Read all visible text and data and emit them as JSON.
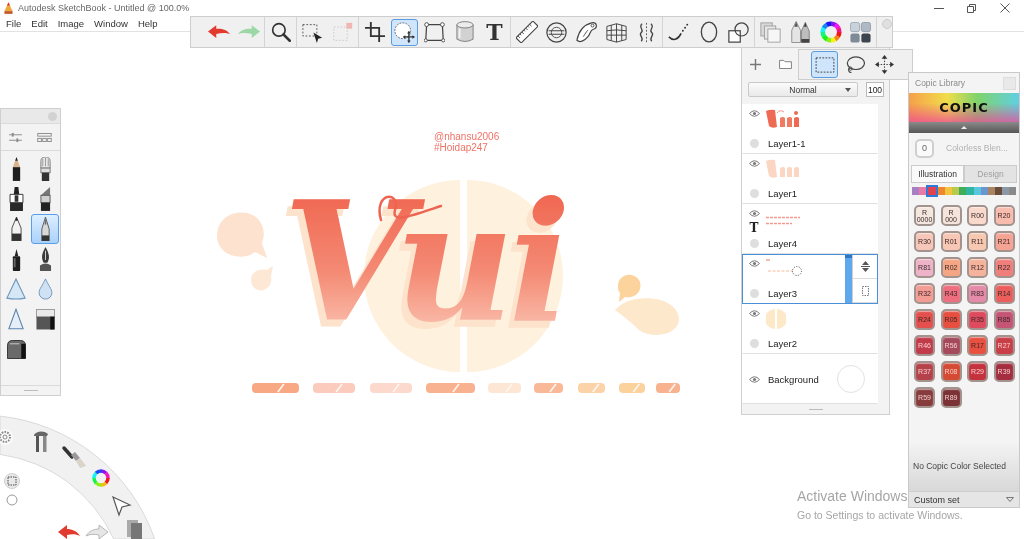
{
  "window": {
    "title": "Autodesk SketchBook - Untitled @ 100.0%"
  },
  "menu": [
    "File",
    "Edit",
    "Image",
    "Window",
    "Help"
  ],
  "toolbar": [
    [
      {
        "kind": "undo",
        "selected": false
      },
      {
        "kind": "redo",
        "selected": false
      }
    ],
    [
      {
        "kind": "zoom",
        "selected": false
      }
    ],
    [
      {
        "kind": "select",
        "selected": false
      },
      {
        "kind": "select-clear",
        "selected": false
      }
    ],
    [
      {
        "kind": "crop",
        "selected": false
      },
      {
        "kind": "transform",
        "selected": true
      },
      {
        "kind": "distort",
        "selected": false
      },
      {
        "kind": "fill",
        "selected": false
      },
      {
        "kind": "text",
        "glyph": "T",
        "selected": false
      }
    ],
    [
      {
        "kind": "ruler",
        "selected": false
      },
      {
        "kind": "ellipse-guide",
        "selected": false
      },
      {
        "kind": "french-curve",
        "selected": false
      },
      {
        "kind": "perspective",
        "selected": false
      },
      {
        "kind": "symmetry",
        "selected": false
      }
    ],
    [
      {
        "kind": "stroke",
        "selected": false
      },
      {
        "kind": "ellipse",
        "selected": false
      },
      {
        "kind": "shapes",
        "selected": false
      }
    ],
    [
      {
        "kind": "copy",
        "selected": false
      },
      {
        "kind": "brushes",
        "selected": false
      },
      {
        "kind": "color",
        "selected": false
      },
      {
        "kind": "swatches",
        "selected": false
      }
    ]
  ],
  "canvas": {
    "credit": [
      "@nhansu2006",
      "#Hoidap247"
    ],
    "lettering": "Vui"
  },
  "brush_palette": {
    "brushes": [
      {
        "kind": "pencil",
        "selected": false
      },
      {
        "kind": "round-brush",
        "selected": false
      },
      {
        "kind": "marker",
        "selected": false
      },
      {
        "kind": "chisel-marker",
        "selected": false
      },
      {
        "kind": "ballpoint",
        "selected": false
      },
      {
        "kind": "fine-pen",
        "selected": true
      },
      {
        "kind": "felt-pen",
        "selected": false
      },
      {
        "kind": "ink-pen",
        "selected": false
      },
      {
        "kind": "soft-triangle",
        "selected": false
      },
      {
        "kind": "drop",
        "selected": false
      },
      {
        "kind": "hard-triangle",
        "selected": false
      },
      {
        "kind": "eraser",
        "selected": false
      },
      {
        "kind": "soft-eraser",
        "selected": false
      }
    ]
  },
  "selection_tools": [
    {
      "kind": "rectangle",
      "selected": true
    },
    {
      "kind": "lasso",
      "selected": false
    },
    {
      "kind": "move",
      "selected": false
    }
  ],
  "layers": {
    "blend_mode": "Normal",
    "opacity": "100",
    "items": [
      {
        "name": "Layer1-1",
        "kind": "paint",
        "visible": true,
        "selected": false
      },
      {
        "name": "Layer1",
        "kind": "paint",
        "visible": true,
        "selected": false
      },
      {
        "name": "Layer4",
        "kind": "text",
        "glyph": "T",
        "visible": true,
        "selected": false
      },
      {
        "name": "Layer3",
        "kind": "paint",
        "visible": true,
        "selected": true
      },
      {
        "name": "Layer2",
        "kind": "paint",
        "visible": true,
        "selected": false
      },
      {
        "name": "Background",
        "kind": "background",
        "visible": true,
        "selected": false
      }
    ]
  },
  "copic": {
    "title": "Copic Library",
    "logo": "COPIC",
    "blender": {
      "code": "0",
      "name": "Colorless Blen..."
    },
    "tabs": [
      {
        "label": "Illustration",
        "selected": true
      },
      {
        "label": "Design",
        "selected": false
      }
    ],
    "families": [
      {
        "color": "#a67fc4",
        "selected": false
      },
      {
        "color": "#e97aa8",
        "selected": false
      },
      {
        "color": "#e0424f",
        "selected": true
      },
      {
        "color": "#f0872f",
        "selected": false
      },
      {
        "color": "#f5c43f",
        "selected": false
      },
      {
        "color": "#b9c94c",
        "selected": false
      },
      {
        "color": "#3fae5c",
        "selected": false
      },
      {
        "color": "#2fb5a0",
        "selected": false
      },
      {
        "color": "#59c6df",
        "selected": false
      },
      {
        "color": "#6a95cf",
        "selected": false
      },
      {
        "color": "#a98460",
        "selected": false
      },
      {
        "color": "#6b4b3b",
        "selected": false
      },
      {
        "color": "#8b99a6",
        "selected": false
      },
      {
        "color": "#8a8a8a",
        "selected": false
      }
    ],
    "swatches": [
      {
        "code": "R 0000",
        "color": "#f3e7df"
      },
      {
        "code": "R 000",
        "color": "#f5e3dc"
      },
      {
        "code": "R00",
        "color": "#f9d9cc"
      },
      {
        "code": "R20",
        "color": "#f8bcae"
      },
      {
        "code": "R30",
        "color": "#f6c7b8"
      },
      {
        "code": "R01",
        "color": "#f8c6b4"
      },
      {
        "code": "R11",
        "color": "#f7c8b0"
      },
      {
        "code": "R21",
        "color": "#f5a494"
      },
      {
        "code": "R81",
        "color": "#eeb3c8"
      },
      {
        "code": "R02",
        "color": "#f5a584"
      },
      {
        "code": "R12",
        "color": "#f6b39c"
      },
      {
        "code": "R22",
        "color": "#f07e7a"
      },
      {
        "code": "R32",
        "color": "#f39c94"
      },
      {
        "code": "R43",
        "color": "#ee6e80"
      },
      {
        "code": "R83",
        "color": "#e58aa8"
      },
      {
        "code": "R14",
        "color": "#ec5e5c"
      },
      {
        "code": "R24",
        "color": "#e4504e"
      },
      {
        "code": "R05",
        "color": "#e74f40"
      },
      {
        "code": "R35",
        "color": "#de4a5e"
      },
      {
        "code": "R85",
        "color": "#c65474"
      },
      {
        "code": "R46",
        "color": "#c13c4b"
      },
      {
        "code": "R56",
        "color": "#a54a5c"
      },
      {
        "code": "R17",
        "color": "#e8503f"
      },
      {
        "code": "R27",
        "color": "#c93f47"
      },
      {
        "code": "R37",
        "color": "#b5424b"
      },
      {
        "code": "R08",
        "color": "#d44a33"
      },
      {
        "code": "R29",
        "color": "#c4323e"
      },
      {
        "code": "R39",
        "color": "#a42d40"
      },
      {
        "code": "R59",
        "color": "#873b3c"
      },
      {
        "code": "R89",
        "color": "#7a3237"
      }
    ],
    "status": "No Copic Color Selected",
    "set": "Custom set"
  },
  "os_notice": {
    "title": "Activate Windows",
    "text": "Go to Settings to activate Windows."
  }
}
